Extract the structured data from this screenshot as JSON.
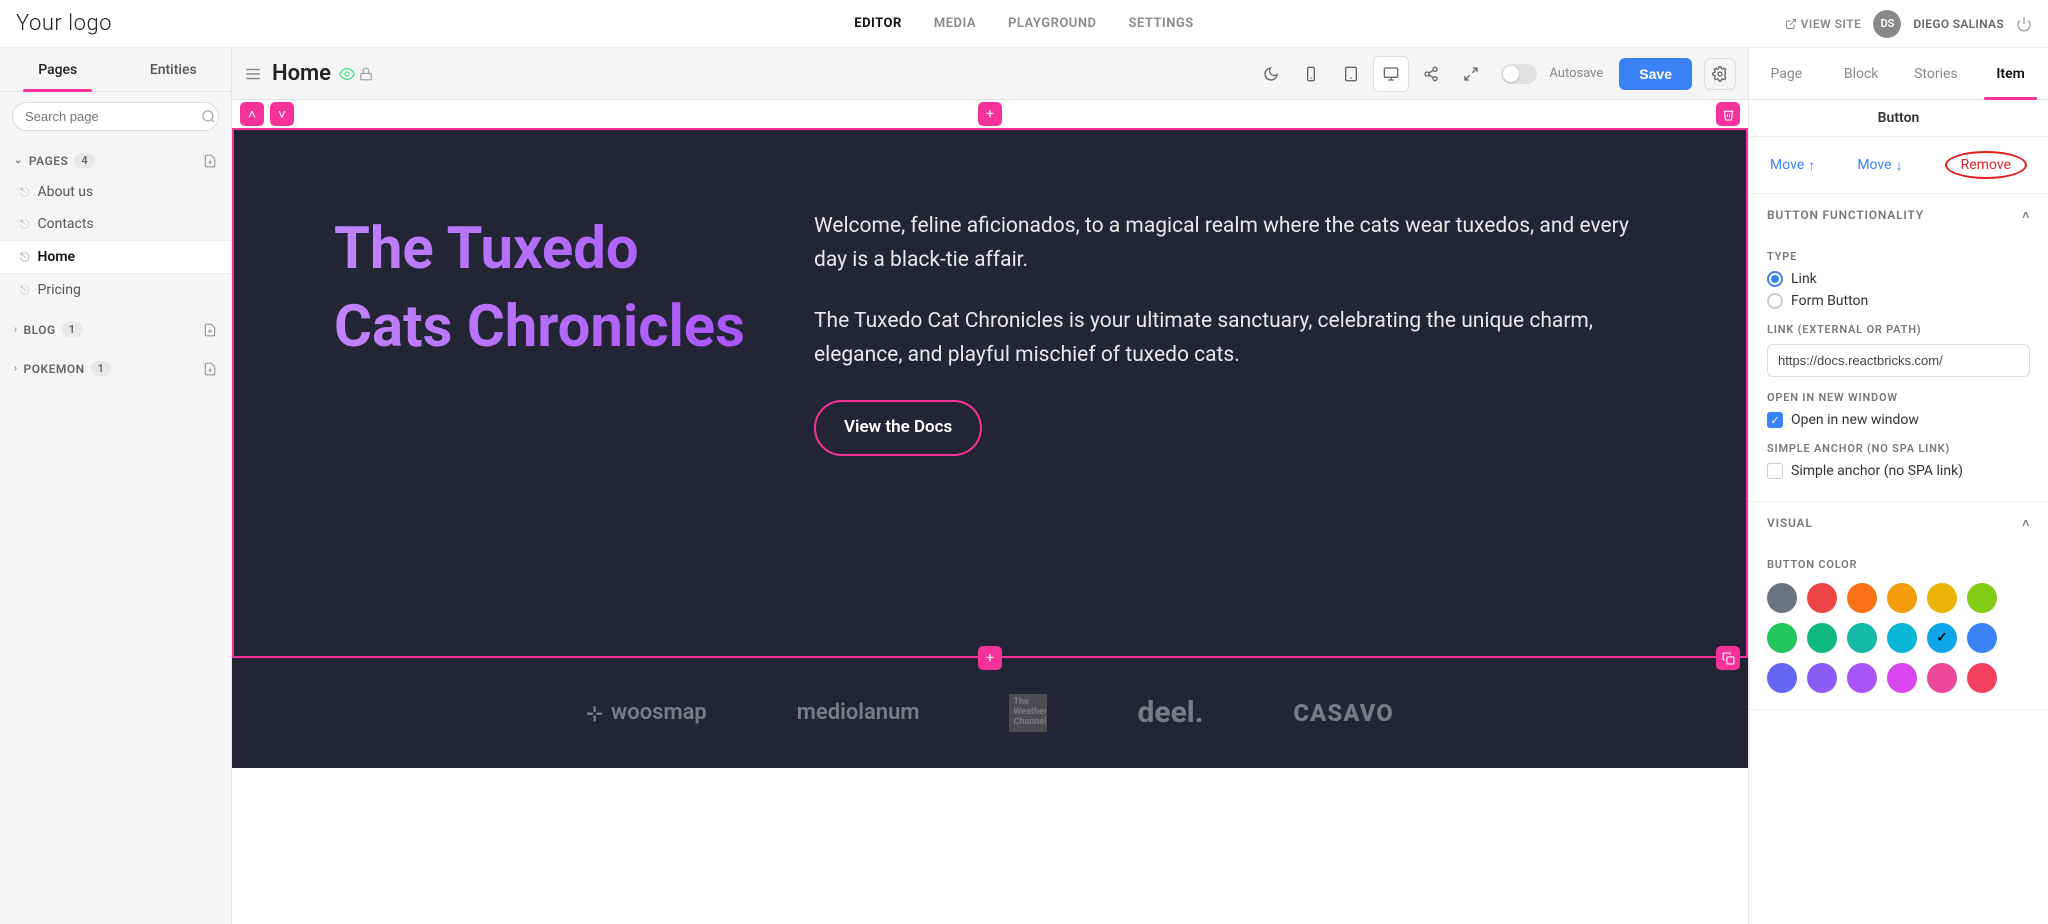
{
  "header": {
    "logo": "Your logo",
    "nav": {
      "editor": "EDITOR",
      "media": "MEDIA",
      "playground": "PLAYGROUND",
      "settings": "SETTINGS"
    },
    "view_site": "VIEW SITE",
    "user_initials": "DS",
    "user_name": "DIEGO SALINAS"
  },
  "left": {
    "tabs": {
      "pages": "Pages",
      "entities": "Entities"
    },
    "search_placeholder": "Search page",
    "groups": {
      "pages": {
        "label": "PAGES",
        "count": "4",
        "items": {
          "about": "About us",
          "contacts": "Contacts",
          "home": "Home",
          "pricing": "Pricing"
        }
      },
      "blog": {
        "label": "BLOG",
        "count": "1"
      },
      "pokemon": {
        "label": "POKEMON",
        "count": "1"
      }
    }
  },
  "editor": {
    "page_title": "Home",
    "autosave_label": "Autosave",
    "save_label": "Save"
  },
  "hero": {
    "title": "The Tuxedo Cats Chronicles",
    "para1": "Welcome, feline aficionados, to a magical realm where the cats wear tuxedos, and every day is a black-tie affair.",
    "para2": "The Tuxedo Cat Chronicles is your ultimate sanctuary, celebrating the unique charm, elegance, and playful mischief of tuxedo cats.",
    "button_label": "View the Docs"
  },
  "logos": {
    "l1": "woosmap",
    "l2": "mediolanum",
    "l3": "The Weather Channel",
    "l4": "deel.",
    "l5": "CASAVO"
  },
  "right": {
    "tabs": {
      "page": "Page",
      "block": "Block",
      "stories": "Stories",
      "item": "Item"
    },
    "panel_title": "Button",
    "actions": {
      "move_up": "Move",
      "move_down": "Move",
      "remove": "Remove"
    },
    "section_functionality": "BUTTON FUNCTIONALITY",
    "type_label": "TYPE",
    "type_link": "Link",
    "type_form": "Form Button",
    "link_label": "LINK (EXTERNAL OR PATH)",
    "link_value": "https://docs.reactbricks.com/",
    "open_new_section": "OPEN IN NEW WINDOW",
    "open_new_label": "Open in new window",
    "anchor_section": "SIMPLE ANCHOR (NO SPA LINK)",
    "anchor_label": "Simple anchor (no SPA link)",
    "visual_section": "VISUAL",
    "color_label": "BUTTON COLOR",
    "colors": [
      "#6b7280",
      "#ef4444",
      "#f97316",
      "#f59e0b",
      "#eab308",
      "#84cc16",
      "#22c55e",
      "#10b981",
      "#14b8a6",
      "#06b6d4",
      "#0ea5e9",
      "#3b82f6",
      "#6366f1",
      "#8b5cf6",
      "#a855f7",
      "#d946ef",
      "#ec4899",
      "#f43f5e"
    ],
    "color_selected_index": 10
  }
}
